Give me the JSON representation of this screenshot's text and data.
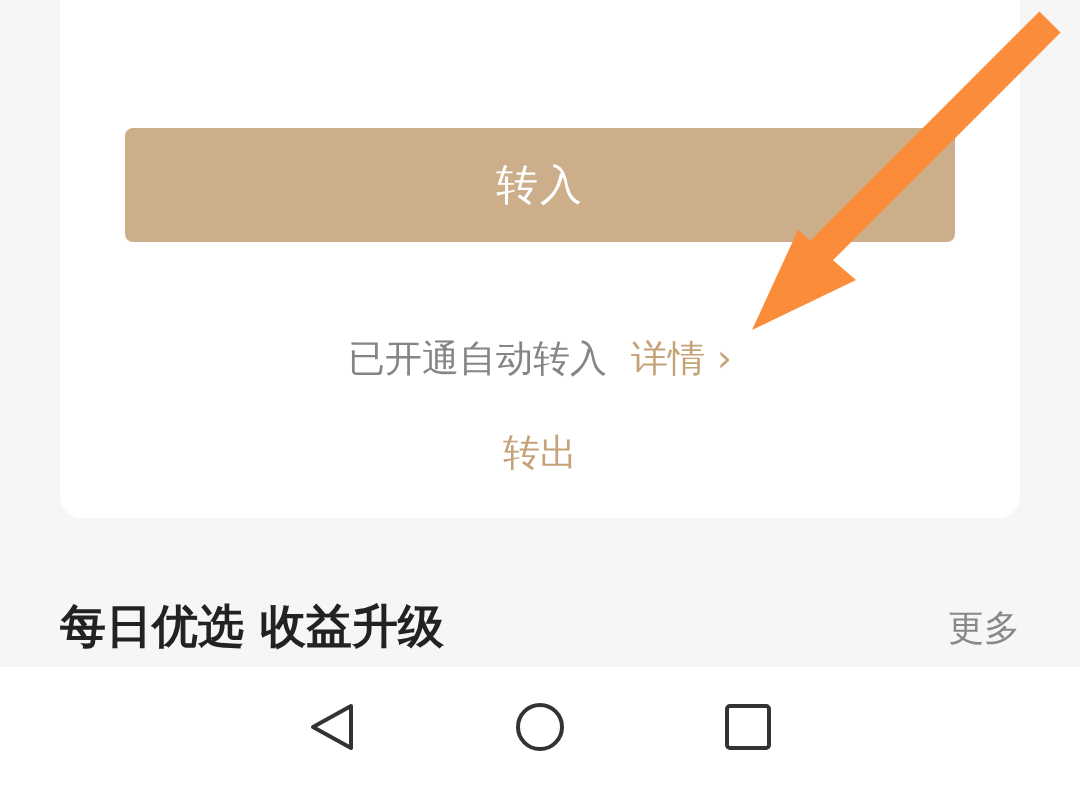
{
  "card": {
    "transfer_in_button": "转入",
    "auto_transfer_status": "已开通自动转入",
    "details_link": "详情 ›",
    "transfer_out_link": "转出"
  },
  "section": {
    "title": "每日优选 收益升级",
    "more_link": "更多"
  }
}
